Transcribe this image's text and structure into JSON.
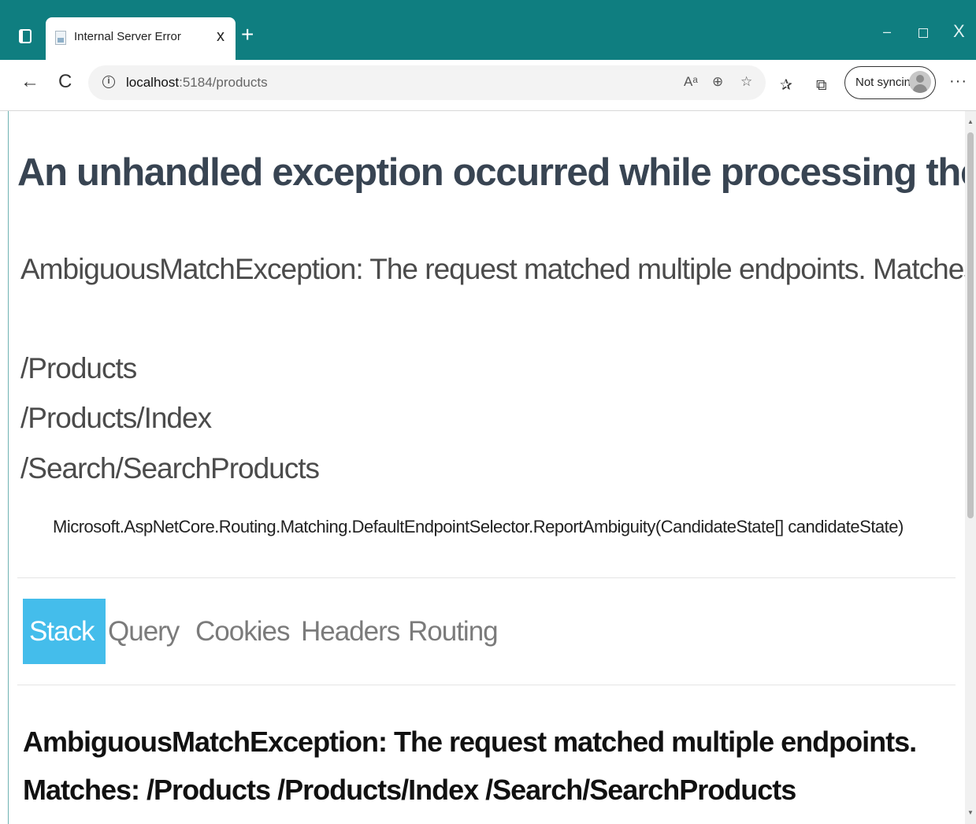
{
  "browser": {
    "tab_title": "Internal Server Error",
    "tab_close": "x",
    "new_tab": "+",
    "window_controls": {
      "minimize": "–",
      "close": "X"
    },
    "url_host": "localhost",
    "url_path": ":5184/products",
    "sync_label": "Not syncing",
    "more": "···",
    "toolbar_icons": {
      "read_aloud": "Aᵃ",
      "zoom": "⊕",
      "favorite_add": "☆",
      "favorites": "✰",
      "collections": "⧉"
    },
    "nav": {
      "back": "←",
      "reload": "C"
    },
    "colors": {
      "titlebar": "#0f7e80",
      "active_tab": "#44bdeb"
    }
  },
  "page": {
    "heading": "An unhandled exception occurred while processing the request.",
    "message": "AmbiguousMatchException: The request matched multiple endpoints. Matches:",
    "endpoints": [
      "/Products",
      "/Products/Index",
      "/Search/SearchProducts"
    ],
    "location": "Microsoft.AspNetCore.Routing.Matching.DefaultEndpointSelector.ReportAmbiguity(CandidateState[] candidateState)",
    "tabs": [
      {
        "label": "Stack",
        "active": true
      },
      {
        "label": "Query",
        "active": false
      },
      {
        "label": "Cookies",
        "active": false
      },
      {
        "label": "Headers",
        "active": false
      },
      {
        "label": "Routing",
        "active": false
      }
    ],
    "stack_heading": "AmbiguousMatchException: The request matched multiple endpoints. Matches: /Products /Products/Index /Search/SearchProducts"
  }
}
